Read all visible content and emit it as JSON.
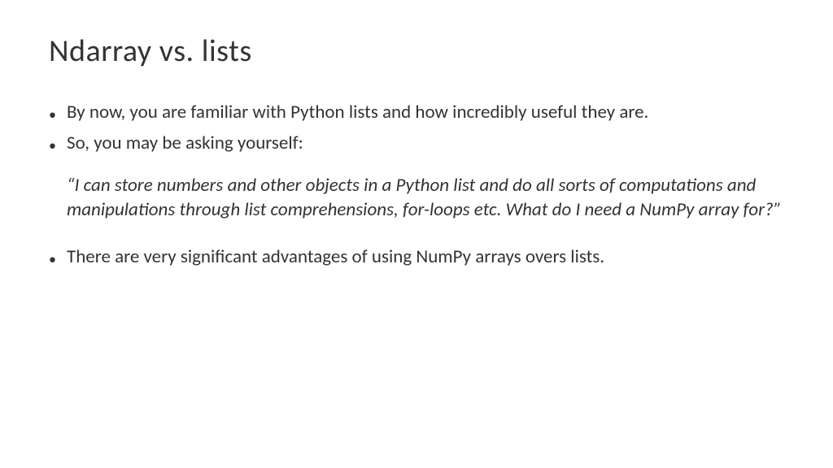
{
  "title": "Ndarray vs. lists",
  "bullets": {
    "b1": "By now, you are familiar with Python lists and how incredibly useful they are.",
    "b2": "So, you may be asking yourself:",
    "b3": "There are very significant advantages of using NumPy arrays overs lists."
  },
  "quote": "“I can store numbers and other objects in a Python list and do all sorts of computations and manipulations through list comprehensions, for-loops etc. What do I need a NumPy array for?”"
}
